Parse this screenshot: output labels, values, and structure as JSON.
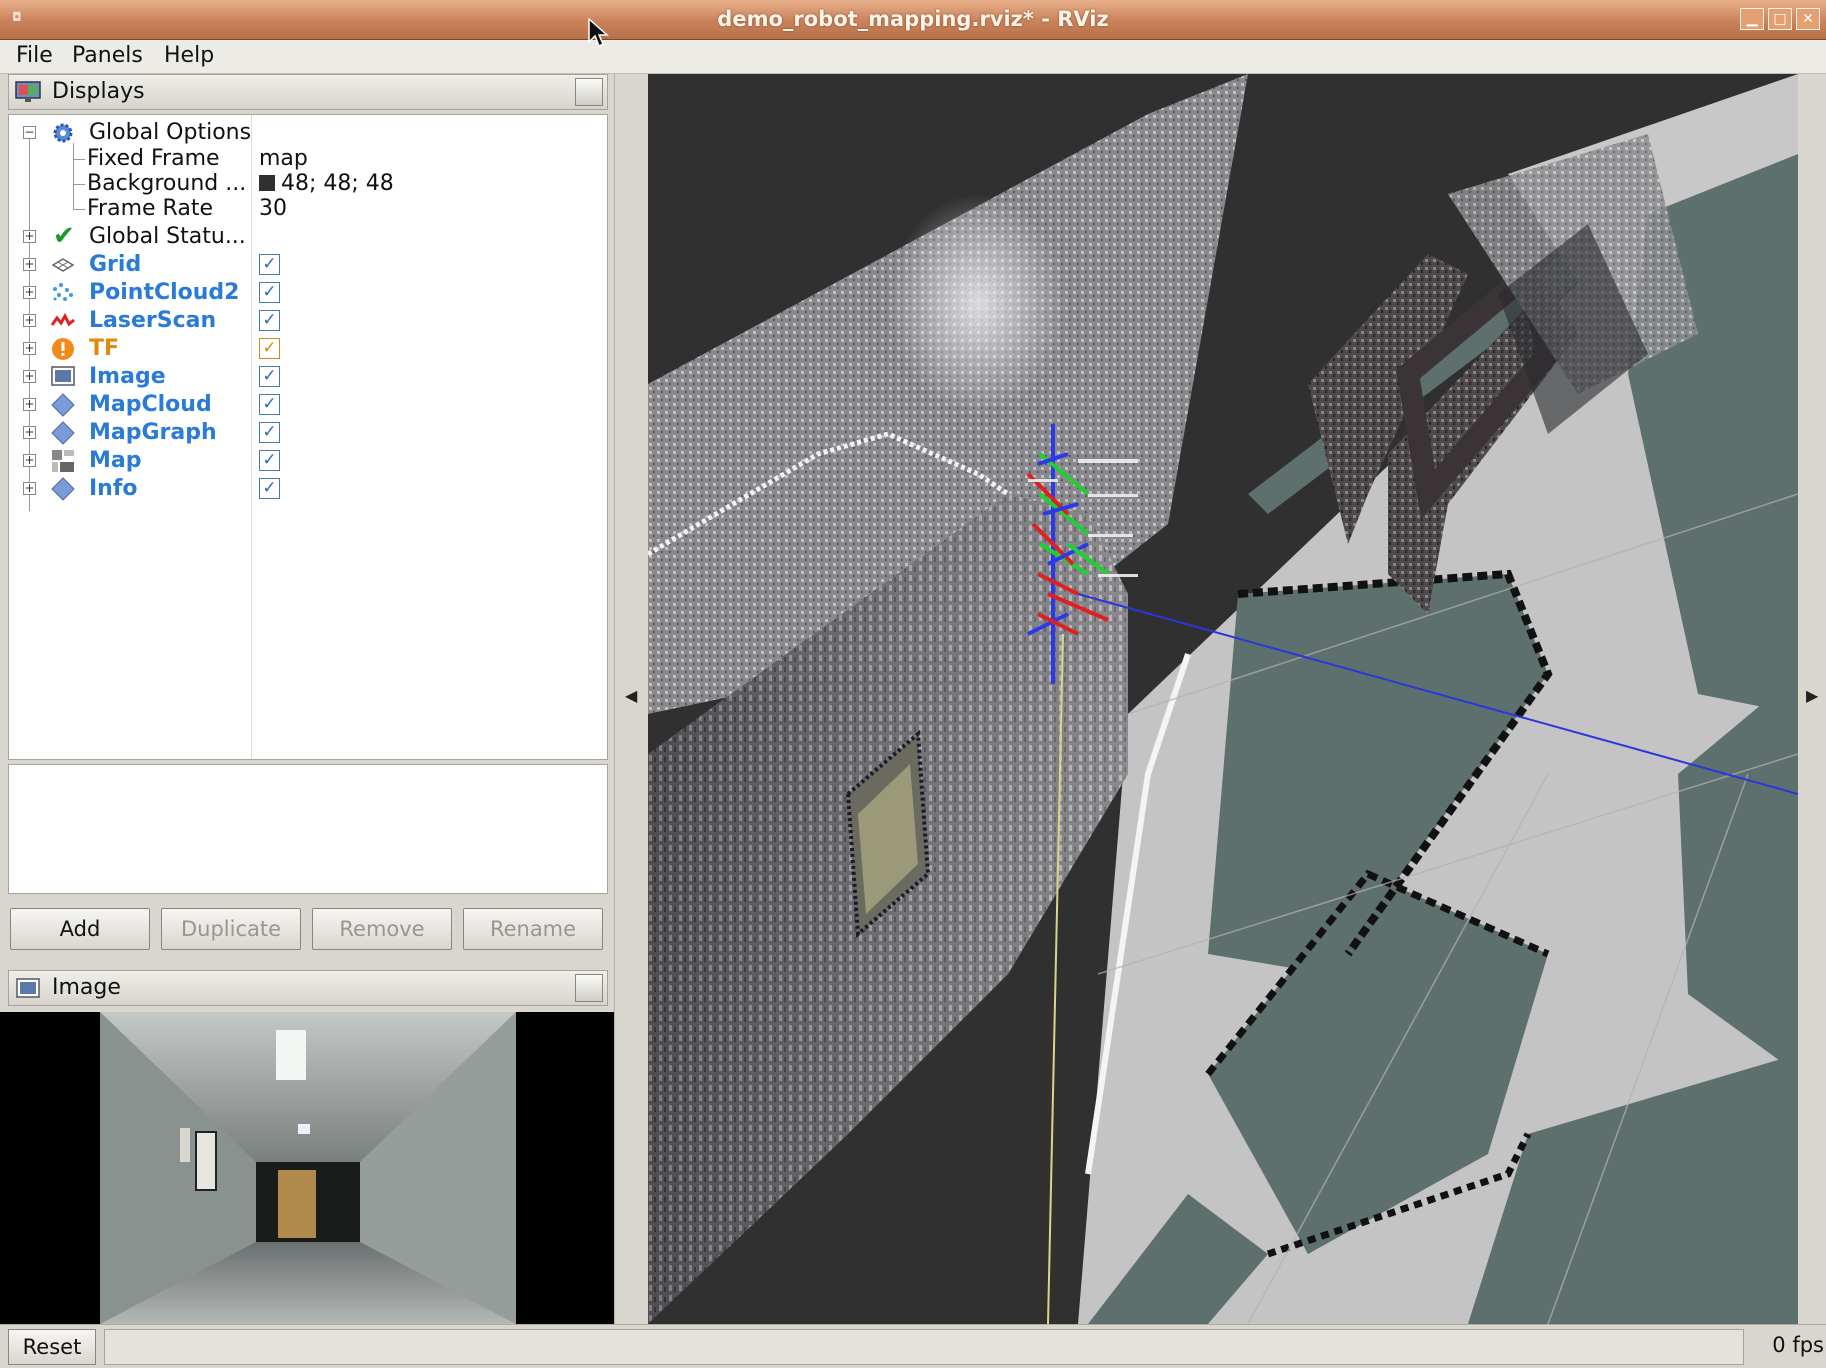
{
  "window": {
    "title": "demo_robot_mapping.rviz* - RViz",
    "controls": [
      "minimize",
      "maximize",
      "close"
    ]
  },
  "menu": [
    {
      "label": "File"
    },
    {
      "label": "Panels"
    },
    {
      "label": "Help"
    }
  ],
  "displays_panel": {
    "title": "Displays",
    "global_options": {
      "label": "Global Options",
      "fixed_frame_label": "Fixed Frame",
      "fixed_frame_value": "map",
      "background_label": "Background ...",
      "background_value": "48; 48; 48",
      "frame_rate_label": "Frame Rate",
      "frame_rate_value": "30"
    },
    "global_status": {
      "label": "Global Statu..."
    },
    "items": [
      {
        "label": "Grid",
        "icon": "grid-icon",
        "checked": true
      },
      {
        "label": "PointCloud2",
        "icon": "pointcloud-icon",
        "checked": true
      },
      {
        "label": "LaserScan",
        "icon": "laserscan-icon",
        "checked": true
      },
      {
        "label": "TF",
        "icon": "tf-warning-icon",
        "checked": true
      },
      {
        "label": "Image",
        "icon": "image-icon",
        "checked": true
      },
      {
        "label": "MapCloud",
        "icon": "diamond-icon",
        "checked": true
      },
      {
        "label": "MapGraph",
        "icon": "diamond-icon",
        "checked": true
      },
      {
        "label": "Map",
        "icon": "map-icon",
        "checked": true
      },
      {
        "label": "Info",
        "icon": "diamond-icon",
        "checked": true
      }
    ],
    "buttons": {
      "add": "Add",
      "duplicate": "Duplicate",
      "remove": "Remove",
      "rename": "Rename"
    }
  },
  "image_panel": {
    "title": "Image"
  },
  "statusbar": {
    "reset": "Reset",
    "fps": "0 fps"
  },
  "colors": {
    "display_label": "#2a7bd8",
    "tf_label": "#e08a10",
    "titlebar": "#c9825a"
  }
}
